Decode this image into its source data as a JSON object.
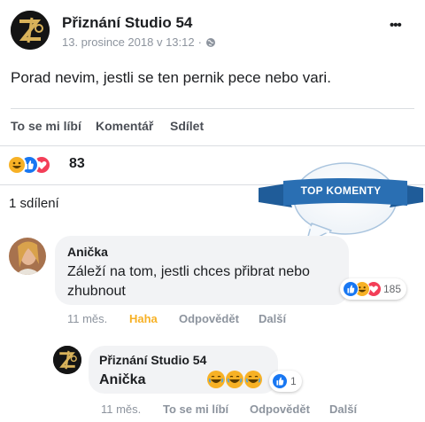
{
  "post": {
    "page_name": "Přiznání Studio 54",
    "timestamp": "13. prosince 2018 v 13:12",
    "separator": "·",
    "text": "Porad nevim, jestli se ten pernik pece nebo vari.",
    "more_menu": "•••"
  },
  "actions": {
    "like": "To se mi líbí",
    "comment": "Komentář",
    "share": "Sdílet"
  },
  "reactions": {
    "count": "83",
    "icons": [
      "haha-icon",
      "like-icon",
      "love-icon"
    ]
  },
  "shares": {
    "text": "1 sdílení"
  },
  "badge": {
    "text": "TOP KOMENTY"
  },
  "comment": {
    "author": "Anička",
    "text_line1": "Záleží na tom, jestli chces přibrat nebo",
    "text_line2": "zhubnout",
    "time": "11 měs.",
    "reaction_label": "Haha",
    "reply_label": "Odpovědět",
    "more_label": "Další",
    "reaction_count": "185",
    "reaction_icons": [
      "like-icon",
      "haha-icon",
      "love-icon"
    ]
  },
  "reply": {
    "author": "Přiznání Studio 54",
    "text": "Anička",
    "emojis": [
      "😂",
      "😂",
      "😂"
    ],
    "time": "11 měs.",
    "like_label": "To se mi líbí",
    "reply_label": "Odpovědět",
    "more_label": "Další",
    "reaction_count": "1",
    "reaction_icons": [
      "like-icon"
    ]
  },
  "colors": {
    "facebook_blue": "#1877f2",
    "haha_yellow": "#f7b125",
    "love_red": "#f33e58",
    "badge_blue": "#2a6fb3",
    "haha_label": "#f7b125"
  }
}
